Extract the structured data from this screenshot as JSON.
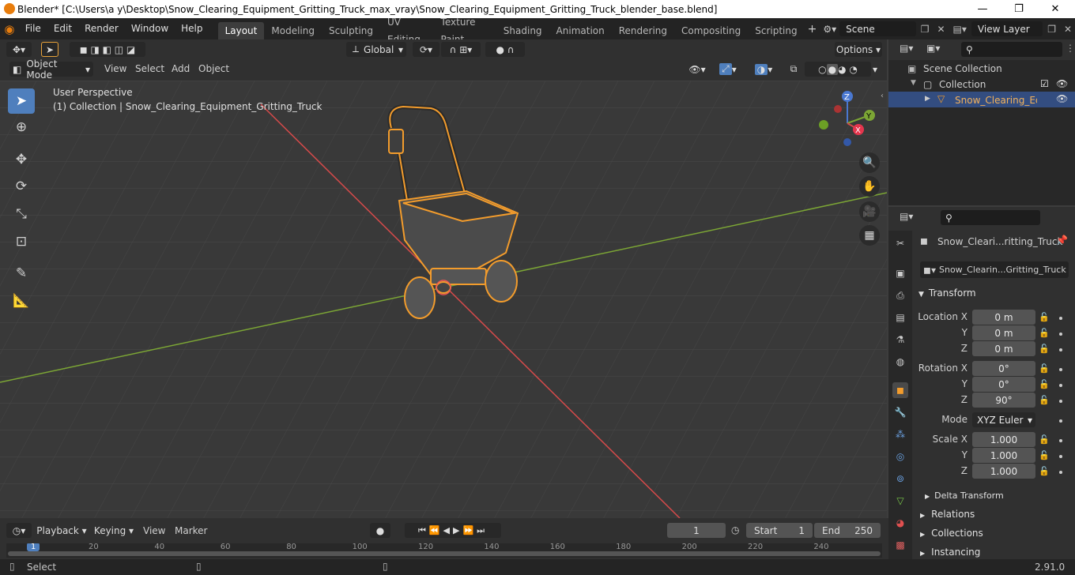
{
  "window": {
    "title": "Blender* [C:\\Users\\a y\\Desktop\\Snow_Clearing_Equipment_Gritting_Truck_max_vray\\Snow_Clearing_Equipment_Gritting_Truck_blender_base.blend]",
    "minimize": "—",
    "maximize": "❐",
    "close": "✕"
  },
  "menu": [
    "File",
    "Edit",
    "Render",
    "Window",
    "Help"
  ],
  "workspaces": [
    "Layout",
    "Modeling",
    "Sculpting",
    "UV Editing",
    "Texture Paint",
    "Shading",
    "Animation",
    "Rendering",
    "Compositing",
    "Scripting"
  ],
  "scene": "Scene",
  "view_layer": "View Layer",
  "header": {
    "transform_orientation": "Global",
    "options": "Options",
    "mode": "Object Mode",
    "view": "View",
    "select": "Select",
    "add": "Add",
    "object": "Object"
  },
  "viewport": {
    "perspective": "User Perspective",
    "collection_info": "(1) Collection | Snow_Clearing_Equipment_Gritting_Truck",
    "gizmo": {
      "x": "X",
      "y": "Y",
      "z": "Z"
    }
  },
  "outliner": {
    "scene_collection": "Scene Collection",
    "collection": "Collection",
    "object": "Snow_Clearing_Equip"
  },
  "properties": {
    "object_name": "Snow_Cleari...ritting_Truck",
    "data_name": "Snow_Clearin...Gritting_Truck",
    "transform": "Transform",
    "location_label": "Location X",
    "rotation_label": "Rotation X",
    "scale_label": "Scale X",
    "y_label": "Y",
    "z_label": "Z",
    "location": [
      "0 m",
      "0 m",
      "0 m"
    ],
    "rotation": [
      "0°",
      "0°",
      "90°"
    ],
    "mode_label": "Mode",
    "mode": "XYZ Euler",
    "scale": [
      "1.000",
      "1.000",
      "1.000"
    ],
    "delta_transform": "Delta Transform",
    "relations": "Relations",
    "collections": "Collections",
    "instancing": "Instancing"
  },
  "timeline": {
    "playback": "Playback",
    "keying": "Keying",
    "view": "View",
    "marker": "Marker",
    "current_frame": "1",
    "start_label": "Start",
    "start": "1",
    "end_label": "End",
    "end": "250",
    "ticks": [
      "1",
      "20",
      "40",
      "60",
      "80",
      "100",
      "120",
      "140",
      "160",
      "180",
      "200",
      "220",
      "240"
    ]
  },
  "status": {
    "select": "Select",
    "version": "2.91.0"
  },
  "colors": {
    "selection": "#f39c2c",
    "x_axis": "#d64a4a",
    "y_axis": "#7ca635",
    "active_tab": "#4f7fbd"
  }
}
